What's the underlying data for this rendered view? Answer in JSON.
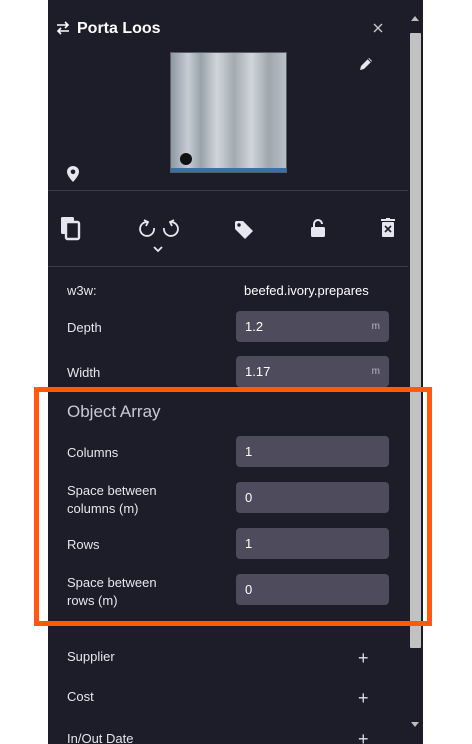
{
  "panel": {
    "title": "Porta Loos",
    "w3w_label": "w3w:",
    "w3w_value": "beefed.ivory.prepares",
    "depth": {
      "label": "Depth",
      "value": "1.2",
      "unit": "m"
    },
    "width": {
      "label": "Width",
      "value": "1.17",
      "unit": "m"
    }
  },
  "object_array": {
    "title": "Object Array",
    "columns": {
      "label": "Columns",
      "value": "1"
    },
    "space_columns": {
      "label_line1": "Space between",
      "label_line2": "columns (m)",
      "value": "0"
    },
    "rows": {
      "label": "Rows",
      "value": "1"
    },
    "space_rows": {
      "label_line1": "Space between",
      "label_line2": "rows (m)",
      "value": "0"
    }
  },
  "sections": {
    "supplier": "Supplier",
    "cost": "Cost",
    "in_out_date": "In/Out Date",
    "plus": "+"
  },
  "icons": {
    "swap": "swap-icon",
    "close": "close-icon",
    "edit": "pencil-icon",
    "pin": "location-pin-icon",
    "copy": "copy-icon",
    "rotate": "rotate-icon",
    "tag": "tag-icon",
    "lock": "lock-icon",
    "delete": "delete-icon"
  },
  "colors": {
    "panel_bg": "#1d1c29",
    "input_bg": "#4e4c5c",
    "highlight": "#ff5a0a"
  }
}
